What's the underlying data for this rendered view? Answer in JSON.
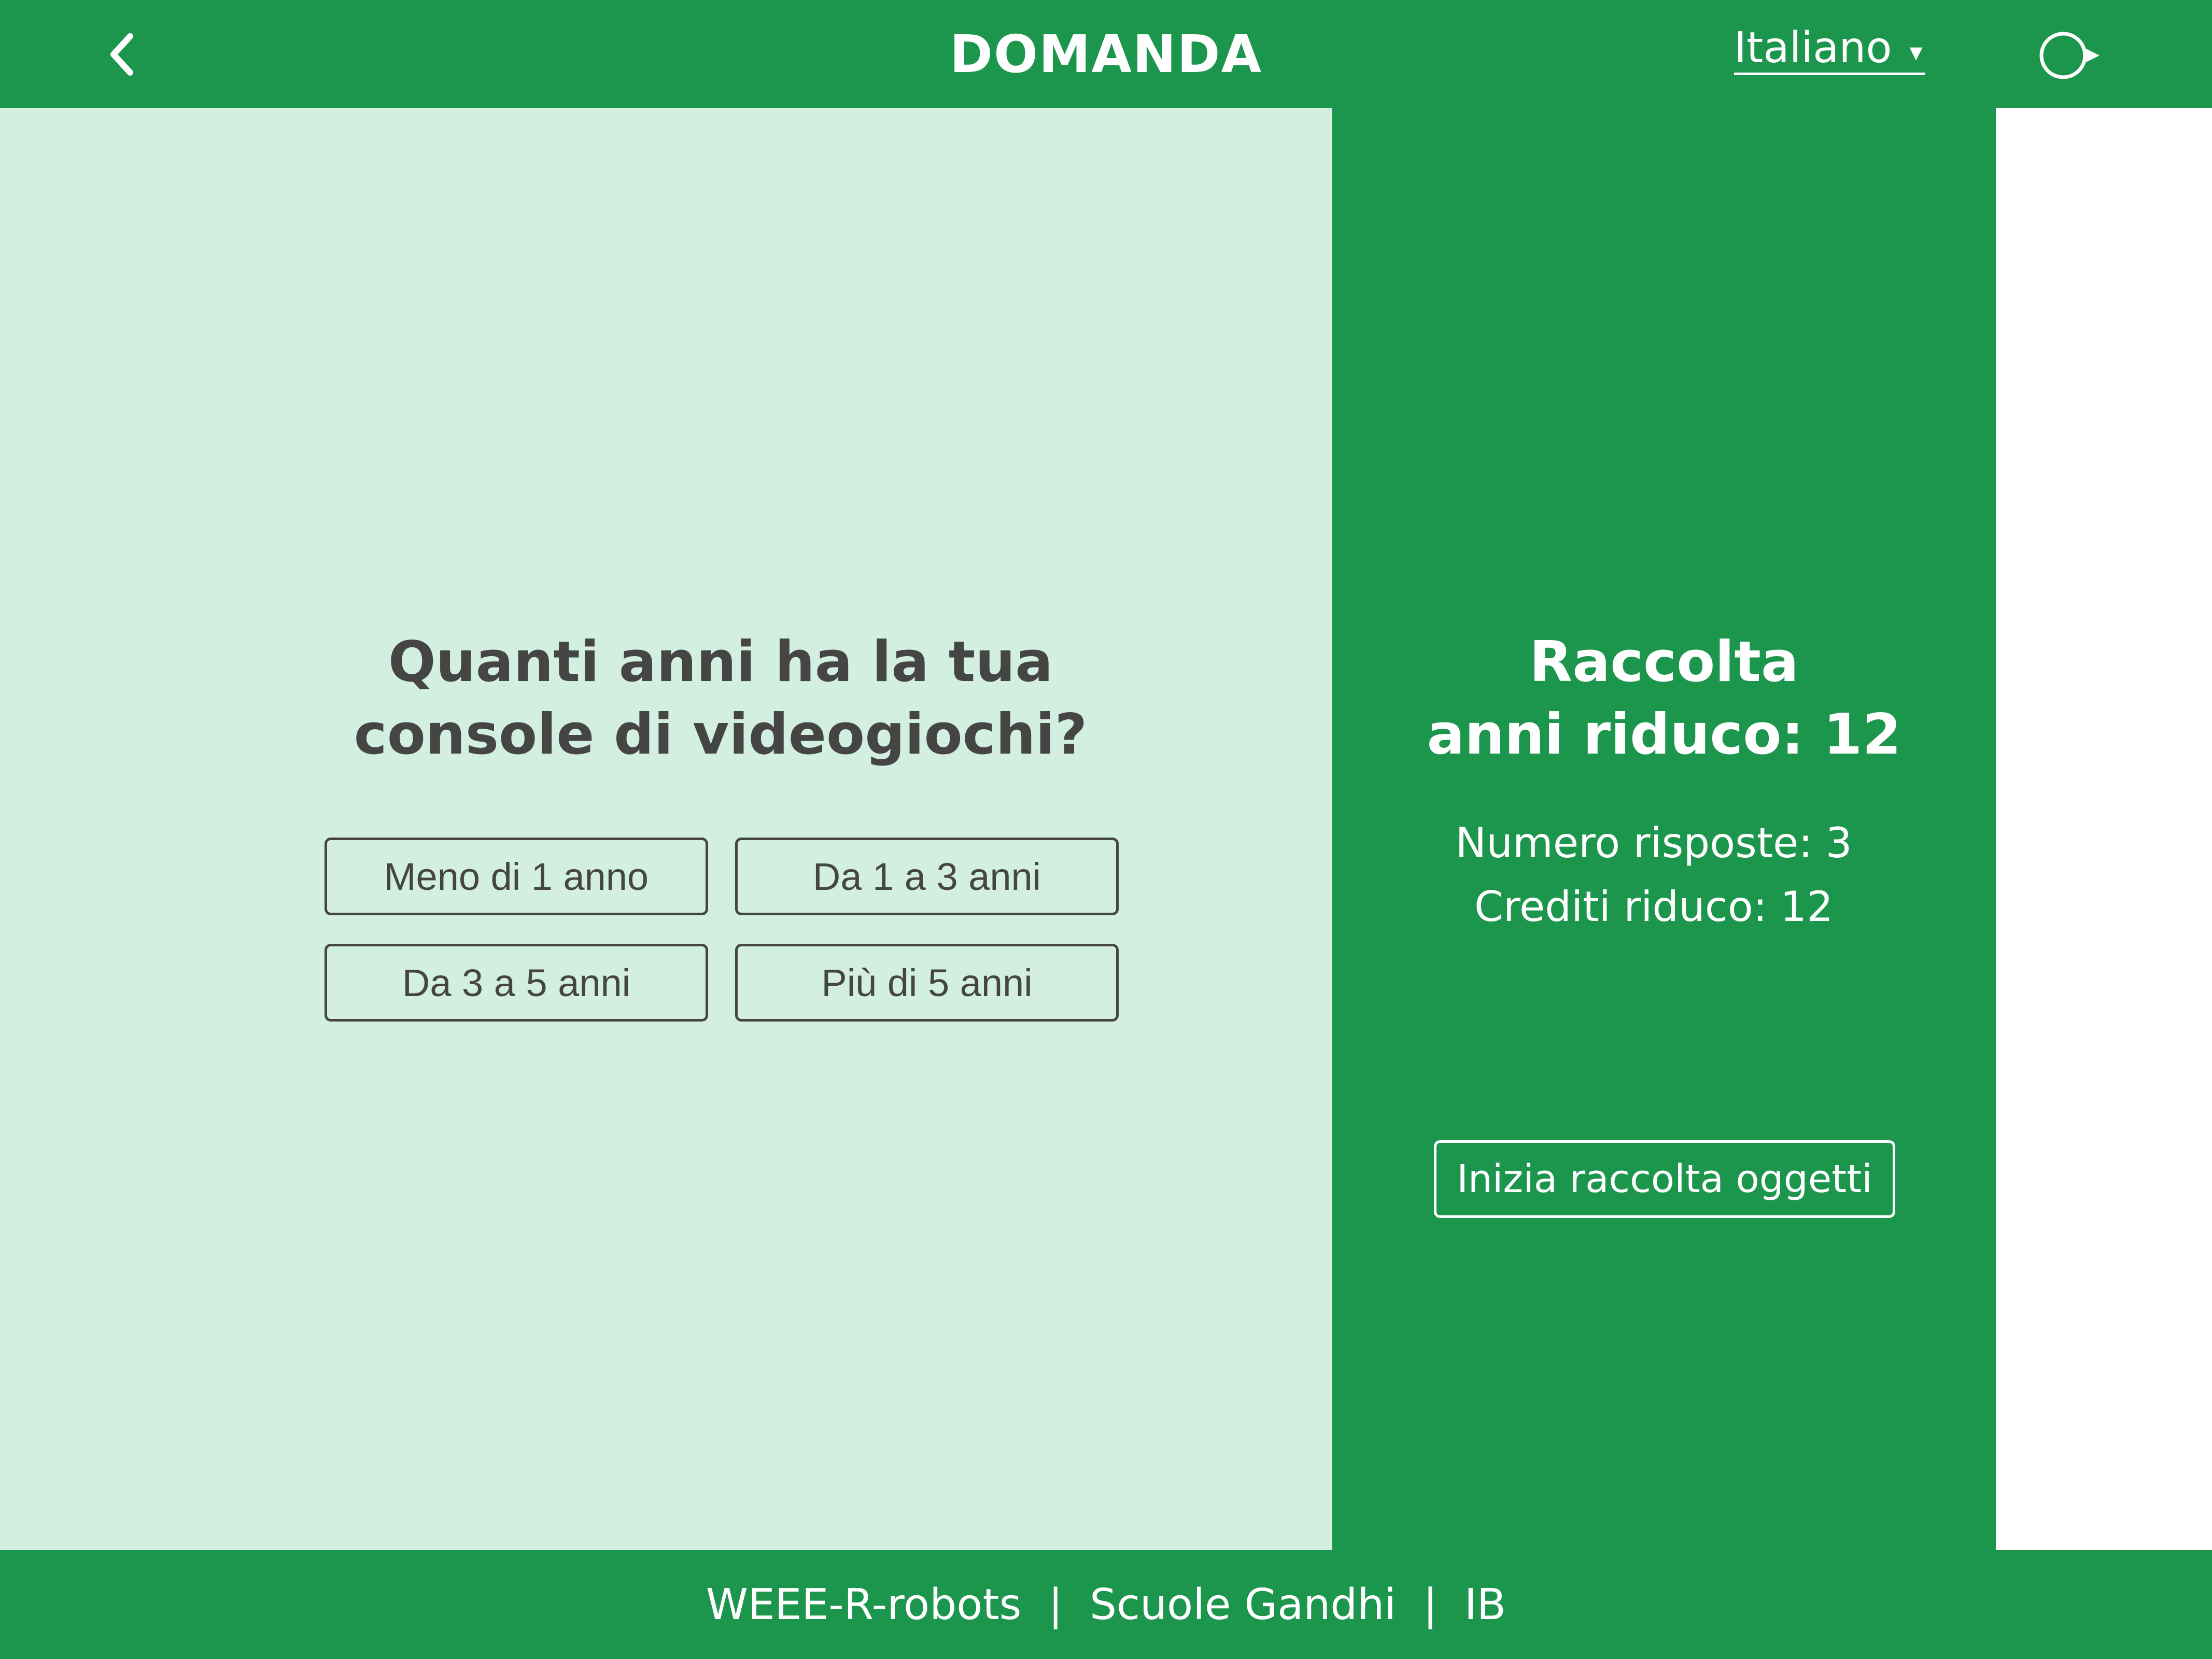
{
  "header": {
    "title": "DOMANDA",
    "back_icon": "chevron-left-icon",
    "language": "Italiano",
    "language_caret": "▾",
    "logout_icon": "logout-icon"
  },
  "question": {
    "line1": "Quanti anni ha la tua",
    "line2": "console di videogiochi?",
    "answers": [
      "Meno di 1 anno",
      "Da 1 a 3 anni",
      "Da 3 a 5 anni",
      "Più di 5 anni"
    ]
  },
  "stats": {
    "title_line1": "Raccolta",
    "title_line2": "anni riduco: 12",
    "responses": "Numero risposte: 3",
    "credits": "Crediti riduco: 12",
    "start_button": "Inizia raccolta oggetti"
  },
  "footer": {
    "project": "WEEE-R-robots",
    "school": "Scuole Gandhi",
    "class_code": "IB",
    "separator": "|"
  },
  "colors": {
    "brand_green": "#1d964d",
    "panel_mint": "#d3efe0",
    "text_dark": "#454545",
    "white": "#ffffff"
  }
}
